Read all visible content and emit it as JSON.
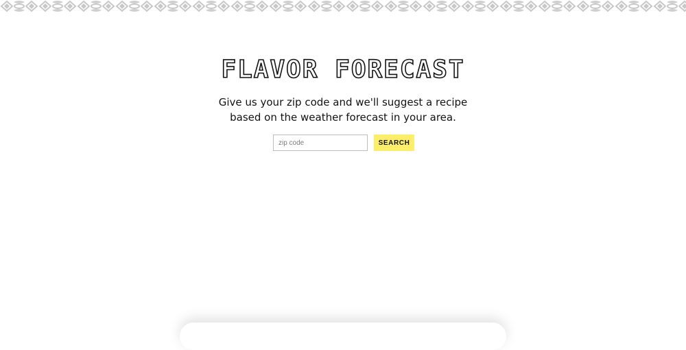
{
  "header": {
    "title": "FLAVOR FORECAST"
  },
  "intro": {
    "text": "Give us your zip code and we'll suggest a recipe based on the weather forecast in your area."
  },
  "search": {
    "placeholder": "zip code",
    "value": "",
    "button_label": "SEARCH"
  },
  "colors": {
    "accent": "#fdee6a",
    "border_pattern": "#c8c8c8",
    "text": "#111111"
  },
  "icons": {
    "border": "decorative-pattern-border"
  }
}
